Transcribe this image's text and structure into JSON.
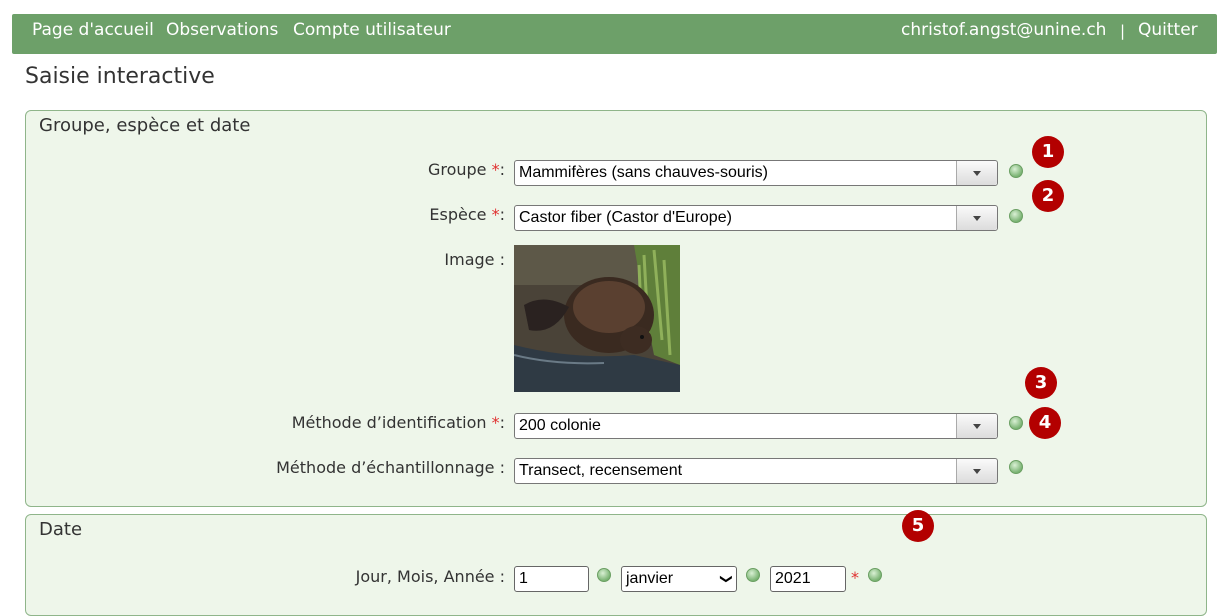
{
  "nav": {
    "home": "Page d'accueil",
    "observations": "Observations",
    "account": "Compte utilisateur",
    "user_email": "christof.angst@unine.ch",
    "separator": "|",
    "logout": "Quitter"
  },
  "page": {
    "title": "Saisie interactive"
  },
  "section1": {
    "title": "Groupe, espèce et date",
    "groupe": {
      "label": "Groupe",
      "required_mark": "*",
      "suffix": ":",
      "value": "Mammifères (sans chauves-souris)"
    },
    "espece": {
      "label": "Espèce",
      "required_mark": "*",
      "suffix": ":",
      "value": "Castor fiber (Castor d'Europe)"
    },
    "image": {
      "label": "Image :"
    },
    "identification": {
      "label": "Méthode d’identification",
      "required_mark": "*",
      "suffix": ":",
      "value": "200 colonie"
    },
    "echantillonnage": {
      "label": "Méthode d’échantillonnage :",
      "value": "Transect, recensement"
    }
  },
  "section2": {
    "title": "Date",
    "date_label": "Jour, Mois, Année :",
    "day": "1",
    "month": "janvier",
    "year": "2021",
    "required_mark": "*"
  },
  "badges": [
    "1",
    "2",
    "3",
    "4",
    "5"
  ],
  "icons": {
    "help": "help-circle-icon",
    "dropdown": "triangle-down-icon"
  },
  "colors": {
    "nav_bg": "#6da069",
    "panel_bg": "#eef6ea",
    "badge": "#b30000",
    "required": "#e03030"
  }
}
